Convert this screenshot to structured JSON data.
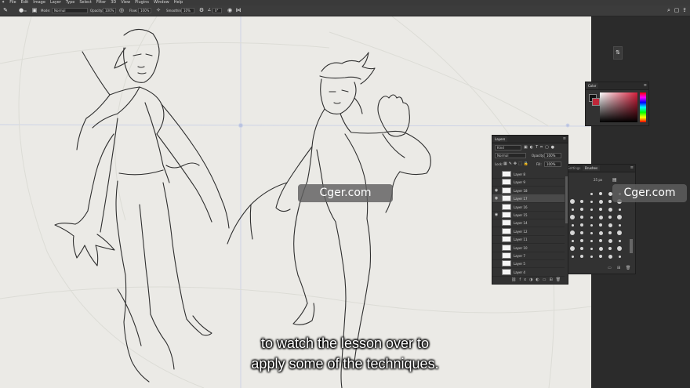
{
  "menu": [
    "File",
    "Edit",
    "Image",
    "Layer",
    "Type",
    "Select",
    "Filter",
    "3D",
    "View",
    "Plugins",
    "Window",
    "Help"
  ],
  "options": {
    "mode_label": "Mode:",
    "mode_value": "Normal",
    "opacity_label": "Opacity:",
    "opacity_value": "100%",
    "flow_label": "Flow:",
    "flow_value": "100%",
    "smoothing_label": "Smoothing:",
    "smoothing_value": "10%",
    "angle_value": "0°",
    "brush_size": "20"
  },
  "color_panel": {
    "title": "Color",
    "fg_color": "#111111",
    "bg_color": "#c0283a"
  },
  "layers_panel": {
    "title": "Layers",
    "filter_label": "Kind",
    "blend_mode": "Normal",
    "opacity_label": "Opacity:",
    "opacity_value": "100%",
    "lock_label": "Lock:",
    "fill_label": "Fill:",
    "fill_value": "100%",
    "layers": [
      {
        "name": "Layer 8",
        "visible": false,
        "selected": false
      },
      {
        "name": "Layer 9",
        "visible": false,
        "selected": false
      },
      {
        "name": "Layer 18",
        "visible": true,
        "selected": false
      },
      {
        "name": "Layer 17",
        "visible": true,
        "selected": true
      },
      {
        "name": "Layer 16",
        "visible": false,
        "selected": false
      },
      {
        "name": "Layer 15",
        "visible": true,
        "selected": false
      },
      {
        "name": "Layer 14",
        "visible": false,
        "selected": false
      },
      {
        "name": "Layer 12",
        "visible": false,
        "selected": false
      },
      {
        "name": "Layer 11",
        "visible": false,
        "selected": false
      },
      {
        "name": "Layer 10",
        "visible": false,
        "selected": false
      },
      {
        "name": "Layer 7",
        "visible": false,
        "selected": false
      },
      {
        "name": "Layer 5",
        "visible": false,
        "selected": false
      },
      {
        "name": "Layer 4",
        "visible": false,
        "selected": false
      }
    ]
  },
  "brushes_panel": {
    "tab_settings": "Settings",
    "tab_brushes": "Brushes",
    "size_value": "25 px"
  },
  "watermarks": [
    "Cger.com",
    "Cger.com"
  ],
  "subtitle": {
    "line1": "to watch the lesson over to",
    "line2": "apply some of the techniques."
  }
}
